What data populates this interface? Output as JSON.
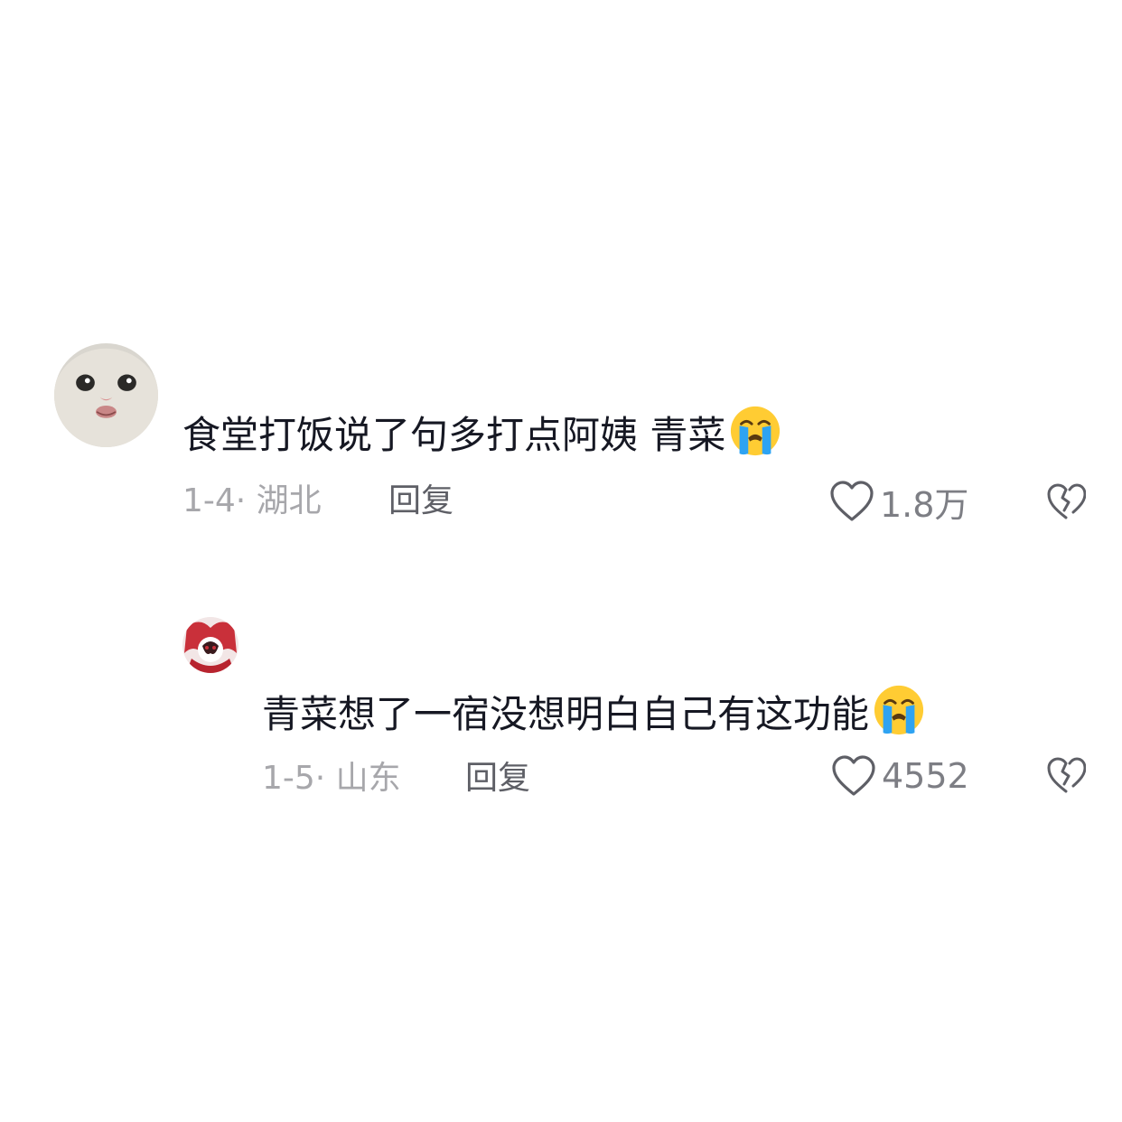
{
  "comments": [
    {
      "avatar_icon": "cat-avatar",
      "text": "食堂打饭说了句多打点阿姨 青菜",
      "emoji": "loudly-crying-face-emoji",
      "meta": "1-4· 湖北",
      "reply_label": "回复",
      "like_count": "1.8万"
    },
    {
      "avatar_icon": "anime-avatar",
      "text": "青菜想了一宿没想明白自己有这功能",
      "emoji": "loudly-crying-face-emoji",
      "meta": "1-5· 山东",
      "reply_label": "回复",
      "like_count": "4552"
    }
  ],
  "colors": {
    "text": "#161823",
    "meta": "#a7a7ab",
    "reply": "#5e5f66",
    "icon": "#5e5f66",
    "emoji_face": "#ffcc33",
    "emoji_tears": "#2ea3f2"
  }
}
